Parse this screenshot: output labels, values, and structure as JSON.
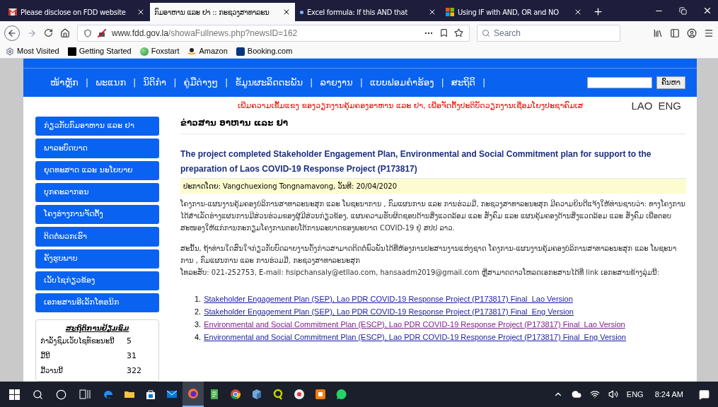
{
  "browser": {
    "tabs": [
      {
        "title": "Please disclose on FDD website",
        "kind": "mail",
        "selected": false
      },
      {
        "title": "ກົມອາຫານ ແລະ ຢາ :: ກະຊວງສາທາລະນ",
        "kind": "plain",
        "selected": true
      },
      {
        "title": "Excel formula: If this AND that",
        "kind": "dot",
        "selected": false
      },
      {
        "title": "Using IF with AND, OR and NO",
        "kind": "windows",
        "selected": false
      }
    ],
    "url_host": "www.fdd.gov.la",
    "url_path": "/showaFullnews.php?newsID=162",
    "search_placeholder": "Search",
    "bookmarks": [
      {
        "label": "Most Visited",
        "kind": "gear"
      },
      {
        "label": "Getting Started",
        "kind": "m"
      },
      {
        "label": "Foxstart",
        "kind": "globe"
      },
      {
        "label": "Amazon",
        "kind": "amazon"
      },
      {
        "label": "Booking.com",
        "kind": "booking"
      }
    ]
  },
  "site": {
    "nav": [
      "ໜ້າຫຼັກ",
      "ພະແນກ",
      "ນິຕິກຳ",
      "ຄູ່ມືຕ່າງໆ",
      "ຂໍ້ມູນຜະລິດຕະພັນ",
      "ລາຍງານ",
      "ແບບຟອມຄຳຮ້ອງ",
      "ສະຖິຕິ"
    ],
    "separator": "|",
    "search_button": "ຄົ້ນຫາ",
    "slogan": "ເພີ່ມຄວາມເຂັ້ມແຂງ ຂອງວຽກງານຄຸ້ມຄອງອາຫານ ແລະ ຢາ, ເພື່ອຈັດຕັ້ງປະຕິບັດວຽກງານເຊື່ອມໂຍງປະຊາຄົມເສ",
    "languages": [
      "LAO",
      "ENG"
    ],
    "sidebar": [
      "ກ່ຽວກັບກົມອາຫານ ແລະ ຢາ",
      "ພາລະບົດບາດ",
      "ຍຸດທະສາດ ແລະ ນະໂຍບາຍ",
      "ບຸກຄະລາກອນ",
      "ໂຄງຮ່າງການຈັດຕັ້ງ",
      "ຕິດຕໍ່ພວກເຮົາ",
      "ຄັງຮູບພາບ",
      "ເວັບໄຊກ່ຽວຂ້ອງ",
      "ເອກະສານອີເລັກໂທຣນິກ"
    ],
    "stats": {
      "title": "ສະຖິຕິການຢ້ຽມຊົມ",
      "rows": [
        {
          "label": "ກຳລັງຊົມເວັບໄຊທ໌ຂະນະນີ້",
          "value": "5"
        },
        {
          "label": "ມື້ນີ້",
          "value": "31"
        },
        {
          "label": "ມື້ວານນີ້",
          "value": "322"
        }
      ]
    },
    "section": "ຂ່າວສານ ອາຫານ ແລະ ຢາ",
    "article": {
      "title": "The project completed Stakeholder Engagement Plan, Environmental and Social Commitment plan for support to the preparation of Laos COVID-19 Response Project (P173817)",
      "byline": "ປະກາດໂດຍ: Vangchuexiong Tongnamavong, ວັນທີ: 20/04/2020",
      "paragraphs": [
        "ໂຄງການ-ແຜນງານຄຸ້ມຄອງບໍລິການສາທາລະນະສຸກ ແລະ ໂພຊະນາການ , ກົມແຜນການ ແລະ ການຮ່ວມມື, ກະຊວງສາທາລະນະສຸກ ມີຄວາມຍິນດີແຈ້ງໃຫ້ທ່ານຊາບວ່າ: ທາງໂຄງການໄດ້ສຳເລັດຮ່າງແຜນການມີສ່ວນຮ່ວມຂອງຜູ້ມີສ່ວນກ່ຽວຂ້ອງ, ແຜນຄວາມຮັບຜິດຊອບດ້ານສິ່ງແວດລ້ອມ ແລະ ສັງຄົມ ແລະ ແຜນຄຸ້ມຄອງດ້ານສິ່ງແວດລ້ອມ ແລະ ສັງຄົມ ເພື່ອຕອບສະໜອງໃຫ້ແກ່ການກະກຽມໂຄງການຕອບໂຕ້ການລະບາດຂອງພະຍາດ COVID-19 ຢູ່ ສປປ ລາວ.",
        "ສະນັ້ນ, ຖ້າທ່ານໃດສົນໃຈກ່ຽວກັບບົດລາຍງານດັ່ງກ່າວສາມາດຕິດຕໍ່ພົວພັນໄດ້ທີ່ຫ້ອງການປະສານງານແຫ່ງຊາດ ໂຄງການ-ແຜນງານຄຸ້ມຄອງບໍລິການສາທາລະນະສຸກ ແລະ ໂພຊະນາການ , ກົມແຜນການ ແລະ ການຮ່ວມມື, ກະຊວງສາທາລະນະສຸກ",
        "ໂທລະສັບ: 021-252753, E-mail: hsipchansaly@etllao.com, hansaadm2019@gmail.com ຫຼືສາມາດດາວໂຫລດເອກະສານໄດ້ທີ່ link ເອກະສານຂ້າງລຸ່ມນີ້:"
      ],
      "links": [
        {
          "number": "1.",
          "text": "Stakeholder Engagement Plan (SEP), Lao PDR COVID-19 Response Project (P173817) Final_Lao Version",
          "visited": false
        },
        {
          "number": "2.",
          "text": "Stakeholder Engagement Plan (SEP), Lao PDR COVID-19 Response Project (P173817) Final_Eng Version",
          "visited": false
        },
        {
          "number": "3.",
          "text": "Environmental and Social Commitment Plan (ESCP), Lao PDR COVID-19 Response Project (P173817) Final_Lao Version",
          "visited": true
        },
        {
          "number": "4.",
          "text": "Environmental and Social Commitment Plan (ESCP), Lao PDR COVID-19 Response Project (P173817) Final_Eng Version",
          "visited": false
        }
      ]
    }
  },
  "taskbar": {
    "apps": [
      {
        "kind": "edge",
        "active": false
      },
      {
        "kind": "folder",
        "active": false
      },
      {
        "kind": "store",
        "active": false
      },
      {
        "kind": "mail",
        "active": false
      },
      {
        "kind": "firefox",
        "active": true
      },
      {
        "kind": "notepad",
        "active": false
      },
      {
        "kind": "chrome",
        "active": false
      },
      {
        "kind": "cube",
        "active": false
      },
      {
        "kind": "q",
        "active": false
      },
      {
        "kind": "disc",
        "active": false
      },
      {
        "kind": "orange",
        "active": false
      },
      {
        "kind": "whatsapp",
        "active": false
      }
    ],
    "language": "ENG",
    "time": "8:24 AM"
  }
}
